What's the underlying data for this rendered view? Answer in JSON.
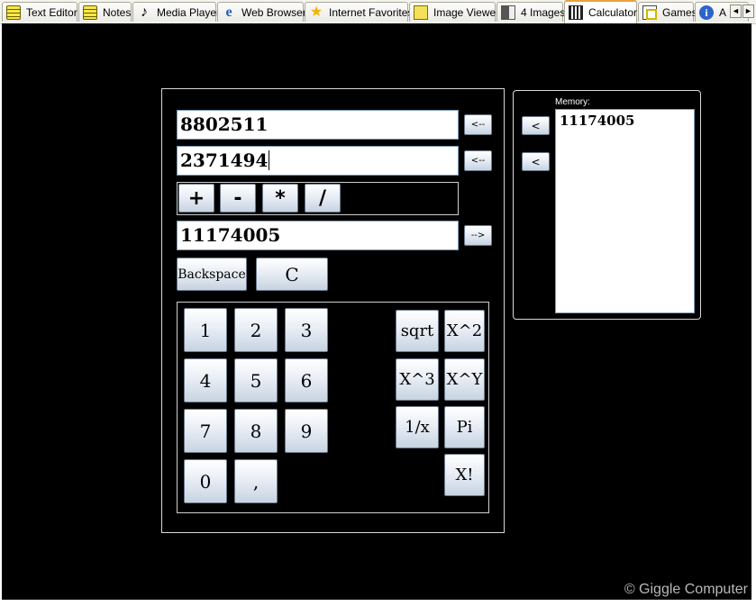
{
  "tabs": [
    {
      "label": "Text Editor",
      "icon": "notepad-icon"
    },
    {
      "label": "Notes",
      "icon": "notes-icon"
    },
    {
      "label": "Media Player",
      "icon": "music-note-icon"
    },
    {
      "label": "Web Browser",
      "icon": "browser-icon"
    },
    {
      "label": "Internet Favorites",
      "icon": "star-icon"
    },
    {
      "label": "Image Viewer",
      "icon": "image-icon"
    },
    {
      "label": "4 Images",
      "icon": "images-icon"
    },
    {
      "label": "Calculator",
      "icon": "calculator-icon",
      "active": true
    },
    {
      "label": "Games",
      "icon": "games-icon"
    },
    {
      "label": "A",
      "icon": "info-icon"
    }
  ],
  "tab_scroll": {
    "left": "◄",
    "right": "►"
  },
  "calculator": {
    "operand1": "8802511",
    "operand2": "2371494",
    "result": "11174005",
    "copy_to_1_label": "<--",
    "copy_to_2_label": "<--",
    "store_result_label": "-->",
    "operators": [
      "+",
      "-",
      "*",
      "/"
    ],
    "backspace_label": "Backspace",
    "clear_label": "C",
    "digits": [
      "1",
      "2",
      "3",
      "4",
      "5",
      "6",
      "7",
      "8",
      "9",
      "0",
      ","
    ],
    "functions": [
      "sqrt",
      "X^2",
      "X^3",
      "X^Y",
      "1/x",
      "Pi",
      "X!"
    ]
  },
  "memory": {
    "title": "Memory:",
    "recall_1_label": "<",
    "recall_2_label": "<",
    "items": [
      "11174005"
    ]
  },
  "footer": {
    "copyright": "© Giggle Computer"
  }
}
